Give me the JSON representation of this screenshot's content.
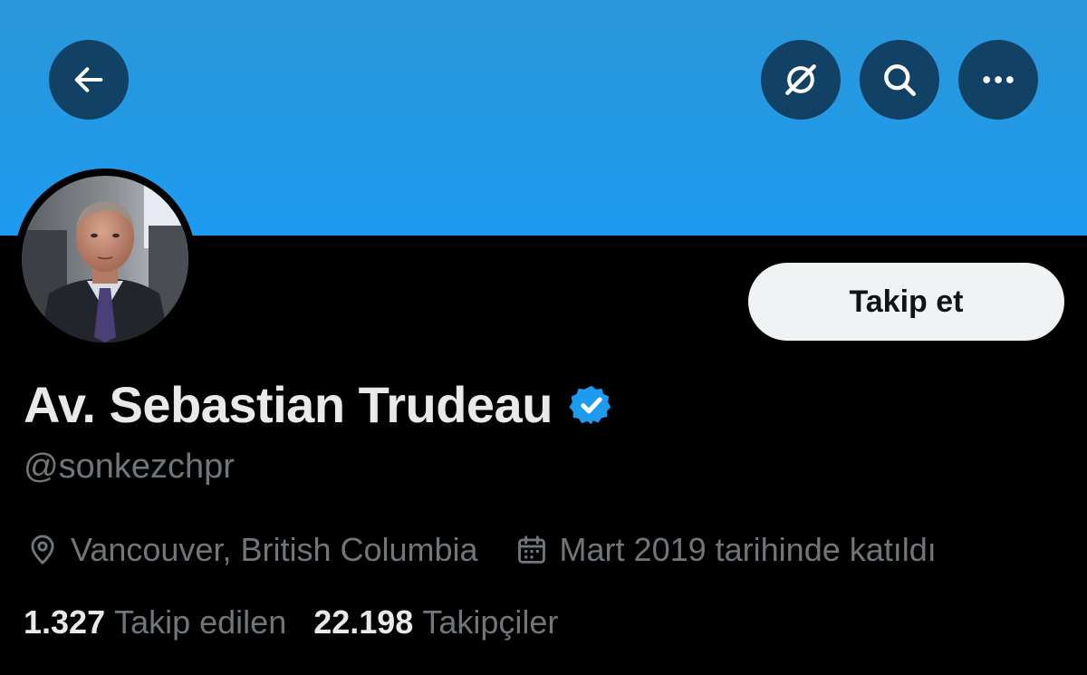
{
  "header": {
    "back_icon": "arrow-left-icon",
    "grok_icon": "grok-icon",
    "search_icon": "search-icon",
    "more_icon": "more-horizontal-icon"
  },
  "profile": {
    "display_name": "Av. Sebastian Trudeau",
    "verified": true,
    "handle": "@sonkezchpr",
    "location": "Vancouver, British Columbia",
    "joined": "Mart 2019 tarihinde katıldı",
    "follow_label": "Takip et"
  },
  "stats": {
    "following_count": "1.327",
    "following_label": "Takip edilen",
    "followers_count": "22.198",
    "followers_label": "Takipçiler"
  },
  "colors": {
    "banner": "#1d9bf0",
    "background": "#000000",
    "primary_text": "#e7e9ea",
    "secondary_text": "#71767b",
    "verified_badge": "#1d9bf0",
    "follow_button_bg": "#eff3f4"
  }
}
